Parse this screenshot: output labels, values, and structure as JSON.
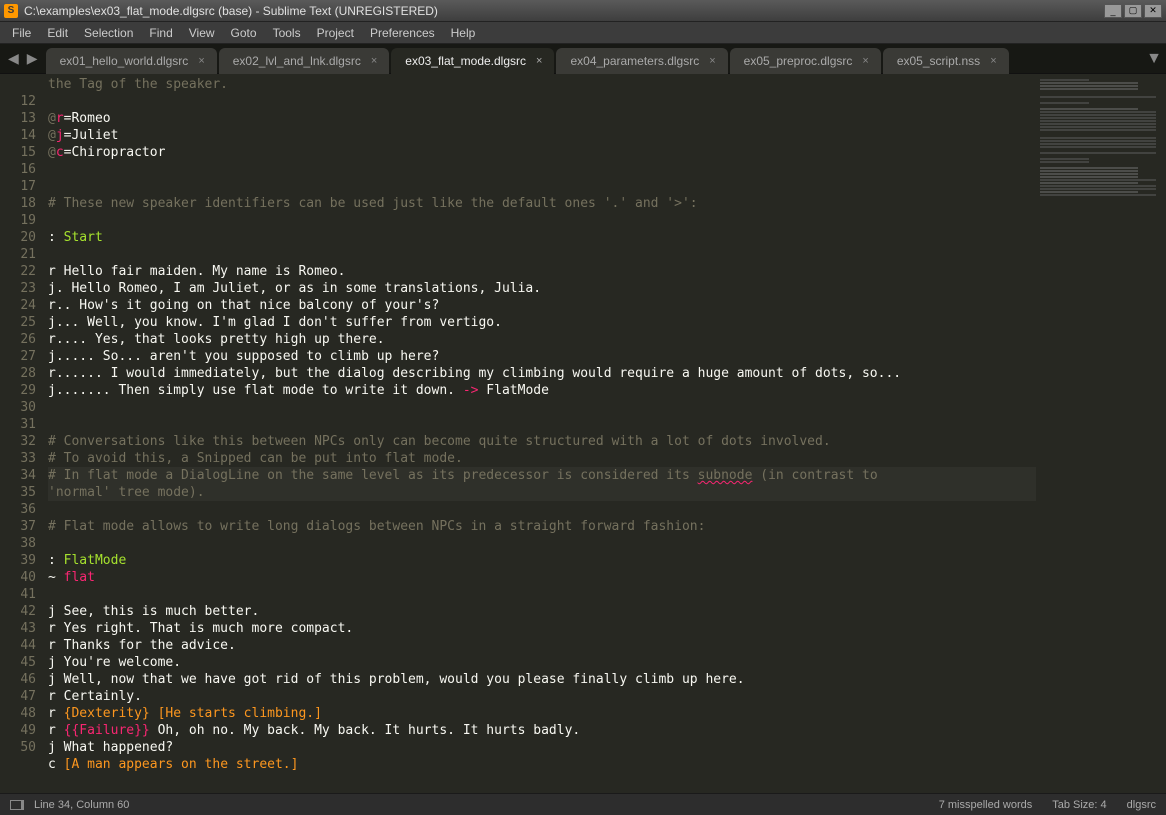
{
  "window": {
    "title": "C:\\examples\\ex03_flat_mode.dlgsrc (base) - Sublime Text (UNREGISTERED)"
  },
  "menu": [
    "File",
    "Edit",
    "Selection",
    "Find",
    "View",
    "Goto",
    "Tools",
    "Project",
    "Preferences",
    "Help"
  ],
  "tabs": [
    {
      "label": "ex01_hello_world.dlgsrc",
      "active": false
    },
    {
      "label": "ex02_lvl_and_lnk.dlgsrc",
      "active": false
    },
    {
      "label": "ex03_flat_mode.dlgsrc",
      "active": true
    },
    {
      "label": "ex04_parameters.dlgsrc",
      "active": false
    },
    {
      "label": "ex05_preproc.dlgsrc",
      "active": false
    },
    {
      "label": "ex05_script.nss",
      "active": false
    }
  ],
  "first_line_number": 12,
  "highlighted_line": 34,
  "code": {
    "11b": "the Tag of the speaker.",
    "13": {
      "at": "@",
      "k": "r",
      "eq": "=Romeo"
    },
    "14": {
      "at": "@",
      "k": "j",
      "eq": "=Juliet"
    },
    "15": {
      "at": "@",
      "k": "c",
      "eq": "=Chiropractor"
    },
    "18": "# These new speaker identifiers can be used just like the default ones '.' and '>':",
    "20": {
      "c": ": ",
      "l": "Start"
    },
    "22": "r Hello fair maiden. My name is Romeo.",
    "23": "j. Hello Romeo, I am Juliet, or as in some translations, Julia.",
    "24": "r.. How's it going on that nice balcony of your's?",
    "25": "j... Well, you know. I'm glad I don't suffer from vertigo.",
    "26": "r.... Yes, that looks pretty high up there.",
    "27": "j..... So... aren't you supposed to climb up here?",
    "28": "r...... I would immediately, but the dialog describing my climbing would require a huge amount of dots, so...",
    "29": {
      "t": "j....... Then simply use flat mode to write it down. ",
      "arrow": "->",
      "l": " FlatMode"
    },
    "32": "# Conversations like this between NPCs only can become quite structured with a lot of dots involved.",
    "33": "# To avoid this, a Snipped can be put into flat mode.",
    "34a": "# In flat mode a DialogLine on the same level as its predecessor is considered its ",
    "34b": "subnode",
    "34c": " (in contrast to ",
    "34d": "'normal' tree mode).",
    "36": "# Flat mode allows to write long dialogs between NPCs in a straight forward fashion:",
    "38": {
      "c": ": ",
      "l": "FlatMode"
    },
    "39": {
      "t": "~ ",
      "f": "flat"
    },
    "41": "j See, this is much better.",
    "42": "r Yes right. That is much more compact.",
    "43": "r Thanks for the advice.",
    "44": "j You're welcome.",
    "45": "j Well, now that we have got rid of this problem, would you please finally climb up here.",
    "46": "r Certainly.",
    "47": {
      "p": "r ",
      "b1": "{Dexterity}",
      "sp": " ",
      "b2": "[He starts climbing.]"
    },
    "48": {
      "p": "r ",
      "f": "{{Failure}}",
      "rest": " Oh, oh no. My back. My back. It hurts. It hurts badly."
    },
    "49": "j What happened?",
    "50": {
      "p": "c ",
      "b": "[A man appears on the street.]"
    }
  },
  "status": {
    "pos": "Line 34, Column 60",
    "spell": "7 misspelled words",
    "tabsize": "Tab Size: 4",
    "syntax": "dlgsrc"
  }
}
